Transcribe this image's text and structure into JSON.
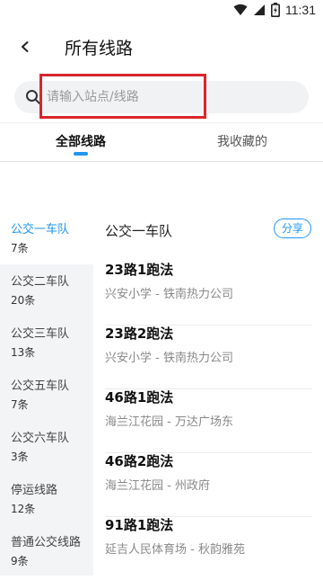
{
  "status_bar": {
    "time": "11:31",
    "icons": [
      "wifi-icon",
      "signal-icon",
      "battery-icon"
    ]
  },
  "header": {
    "title": "所有线路",
    "back_icon": "chevron-left-icon"
  },
  "search": {
    "placeholder": "请输入站点/线路",
    "icon": "search-icon"
  },
  "tabs": [
    {
      "label": "全部线路",
      "active": true
    },
    {
      "label": "我收藏的",
      "active": false
    }
  ],
  "sidebar": {
    "items": [
      {
        "name": "公交一车队",
        "count": "7条",
        "active": true
      },
      {
        "name": "公交二车队",
        "count": "20条",
        "active": false
      },
      {
        "name": "公交三车队",
        "count": "13条",
        "active": false
      },
      {
        "name": "公交五车队",
        "count": "7条",
        "active": false
      },
      {
        "name": "公交六车队",
        "count": "3条",
        "active": false
      },
      {
        "name": "停运线路",
        "count": "12条",
        "active": false
      },
      {
        "name": "普通公交线路",
        "count": "9条",
        "active": false
      }
    ]
  },
  "content": {
    "group_title": "公交一车队",
    "share_label": "分享",
    "routes": [
      {
        "name": "23路1跑法",
        "stops": "兴安小学 - 铁南热力公司"
      },
      {
        "name": "23路2跑法",
        "stops": "兴安小学 - 铁南热力公司"
      },
      {
        "name": "46路1跑法",
        "stops": "海兰江花园 - 万达广场东"
      },
      {
        "name": "46路2跑法",
        "stops": "海兰江花园 - 州政府"
      },
      {
        "name": "91路1跑法",
        "stops": "延吉人民体育场 - 秋韵雅苑"
      }
    ]
  },
  "colors": {
    "accent": "#2196f3",
    "highlight_box": "#d8262b",
    "sidebar_bg": "#f3f4f6"
  }
}
